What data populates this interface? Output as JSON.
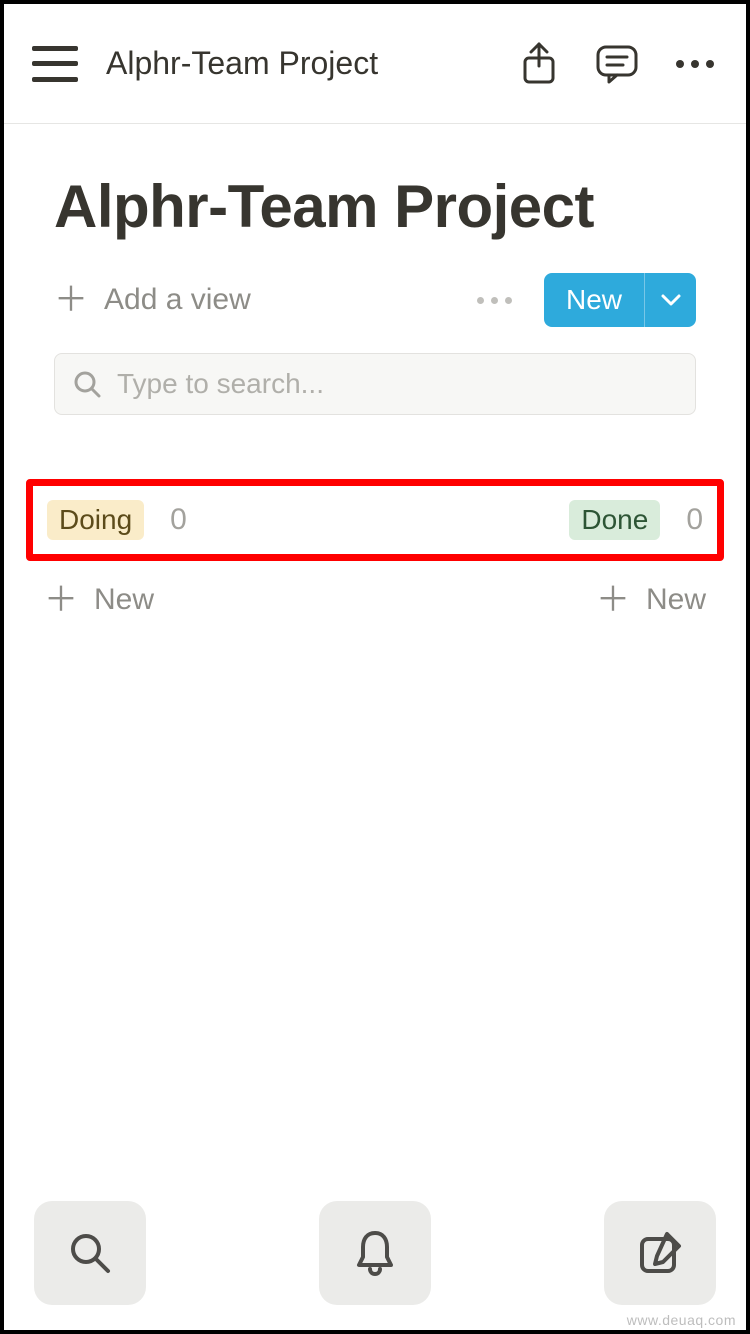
{
  "header": {
    "breadcrumb": "Alphr-Team Project"
  },
  "page": {
    "title": "Alphr-Team Project"
  },
  "viewbar": {
    "add_view_label": "Add a view",
    "new_button_label": "New"
  },
  "search": {
    "placeholder": "Type to search..."
  },
  "board": {
    "columns": [
      {
        "name": "Doing",
        "count": "0",
        "tag_class": "tag-doing"
      },
      {
        "name": "Done",
        "count": "0",
        "tag_class": "tag-done"
      }
    ],
    "new_item_label": "New"
  },
  "watermark": "www.deuaq.com"
}
